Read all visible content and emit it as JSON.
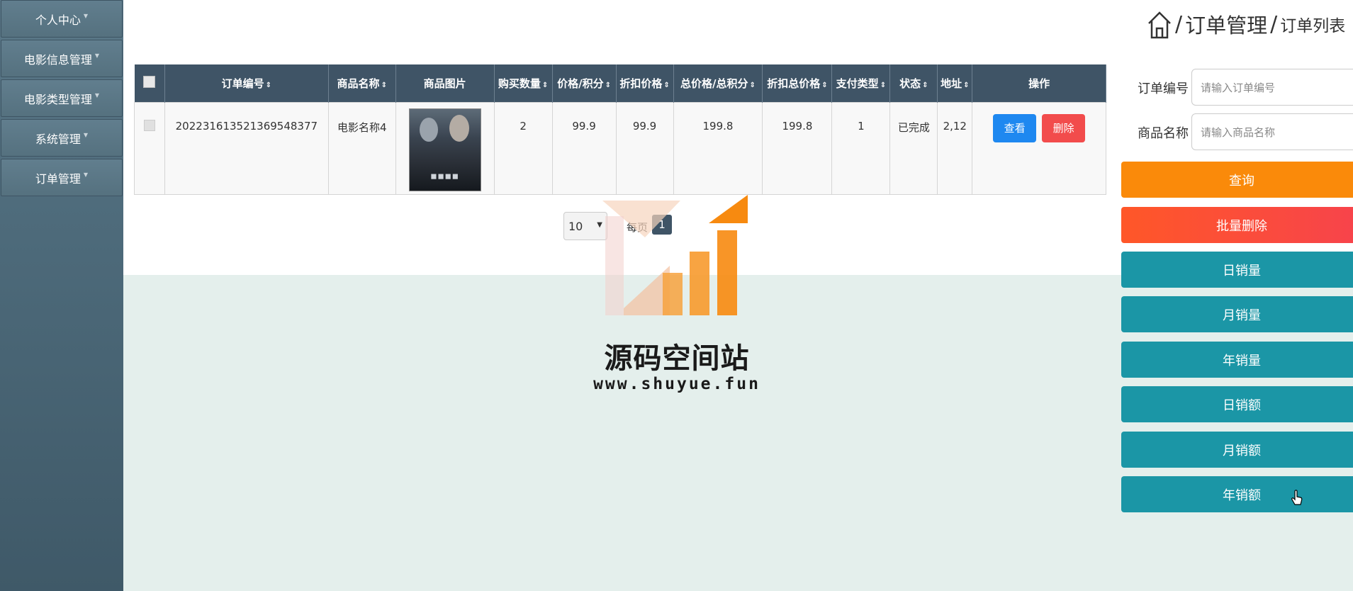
{
  "sidebar": {
    "items": [
      {
        "label": "个人中心"
      },
      {
        "label": "电影信息管理"
      },
      {
        "label": "电影类型管理"
      },
      {
        "label": "系统管理"
      },
      {
        "label": "订单管理"
      }
    ]
  },
  "breadcrumb": {
    "home_icon": "home-icon",
    "level1": "订单管理",
    "level2": "订单列表",
    "separator": "/"
  },
  "table": {
    "columns": [
      "订单编号",
      "商品名称",
      "商品图片",
      "购买数量",
      "价格/积分",
      "折扣价格",
      "总价格/总积分",
      "折扣总价格",
      "支付类型",
      "状态",
      "地址",
      "操作"
    ],
    "sort_icon": "⇕",
    "rows": [
      {
        "order_no": "20223161352136954837​7",
        "product_name": "电影名称4",
        "quantity": "2",
        "price": "99.9",
        "discount_price": "99.9",
        "total_price": "199.8",
        "discount_total": "199.8",
        "pay_type": "1",
        "status": "已完成",
        "address": "2,12",
        "view_label": "查看",
        "delete_label": "删除"
      }
    ]
  },
  "pager": {
    "page_size": "10",
    "per_page_label": "每页",
    "current_page": "1"
  },
  "watermark": {
    "title": "源码空间站",
    "url": "www.shuyue.fun"
  },
  "search": {
    "order_no_label": "订单编号",
    "order_no_placeholder": "请输入订单编号",
    "product_label": "商品名称",
    "product_placeholder": "请输入商品名称",
    "query_label": "查询",
    "batch_delete_label": "批量删除",
    "buttons": [
      "日销量",
      "月销量",
      "年销量",
      "日销额",
      "月销额",
      "年销额"
    ]
  },
  "colors": {
    "header_bg": "#3f5466",
    "orange": "#fa8a0a",
    "red": "#f7434c",
    "teal": "#1b96a6",
    "view_blue": "#1e88f0"
  }
}
